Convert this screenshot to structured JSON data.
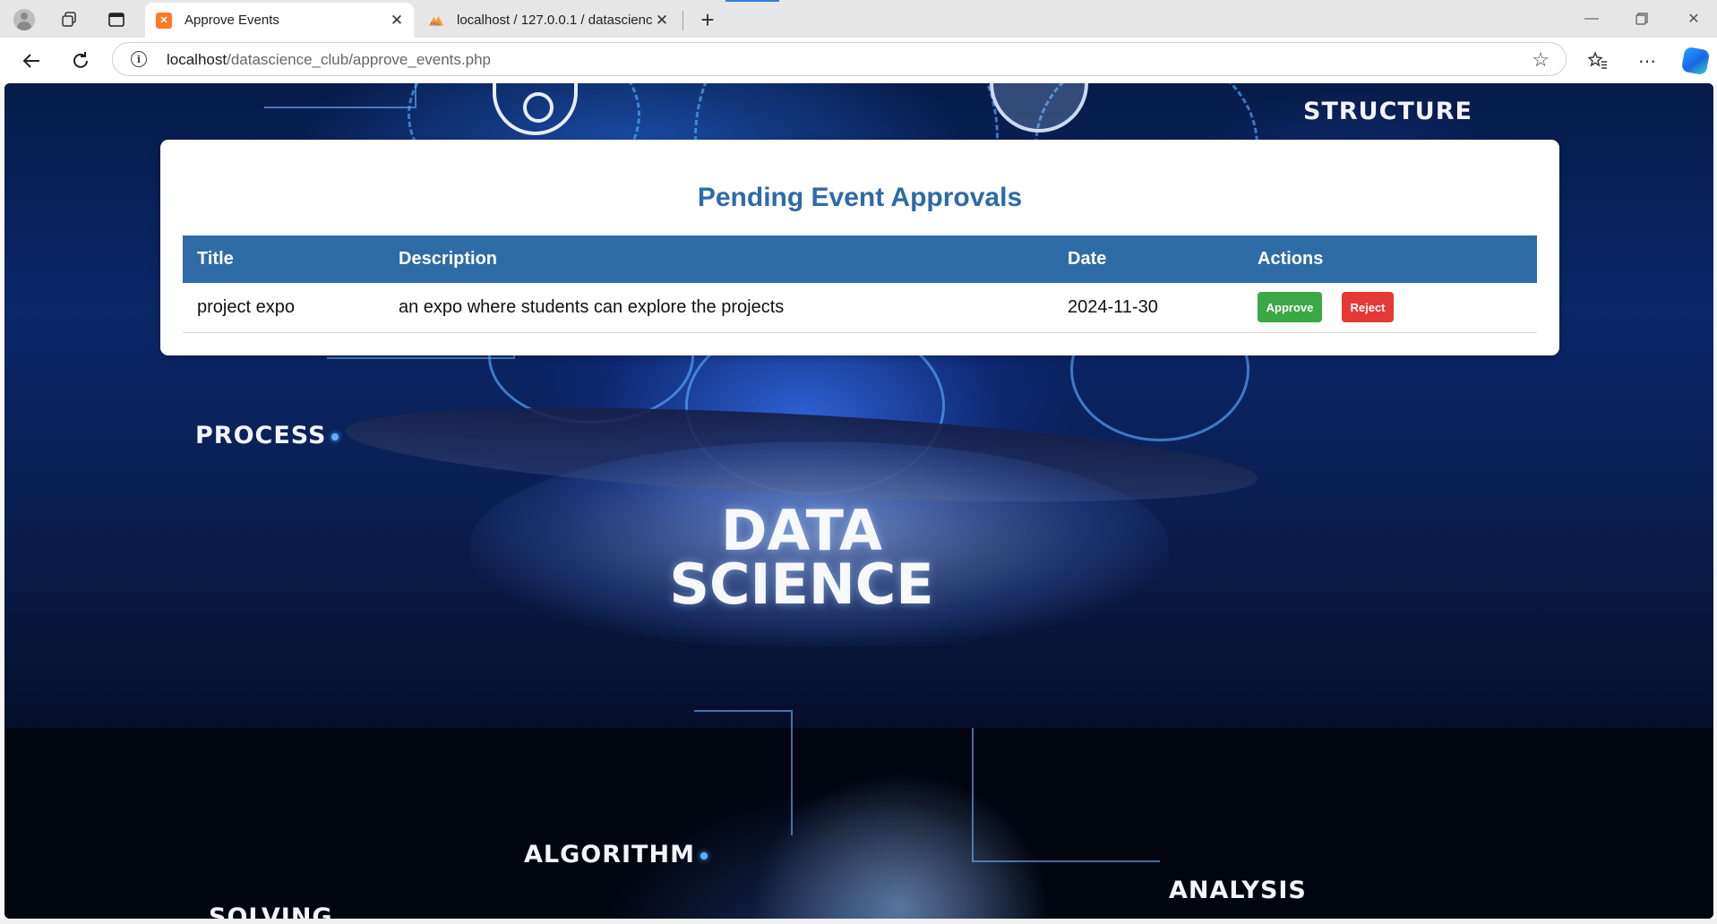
{
  "browser": {
    "tabs": [
      {
        "title": "Approve Events",
        "active": true,
        "favicon": "xampp-icon"
      },
      {
        "title": "localhost / 127.0.0.1 / datascience",
        "active": false,
        "favicon": "phpmyadmin-icon"
      }
    ],
    "address": {
      "host": "localhost",
      "path": "/datascience_club/approve_events.php"
    }
  },
  "background": {
    "words": {
      "structure": "STRUCTURE",
      "process": "PROCESS",
      "algorithm": "ALGORITHM",
      "analysis": "ANALYSIS",
      "solving": "SOLVING"
    },
    "title_line1": "DATA",
    "title_line2": "SCIENCE"
  },
  "page": {
    "heading": "Pending Event Approvals",
    "columns": [
      "Title",
      "Description",
      "Date",
      "Actions"
    ],
    "rows": [
      {
        "title": "project expo",
        "description": "an expo where students can explore the projects",
        "date": "2024-11-30",
        "approve_label": "Approve",
        "reject_label": "Reject"
      }
    ]
  },
  "colors": {
    "heading": "#2d6aa9",
    "table_header": "#2f6ba6",
    "approve": "#3aa845",
    "reject": "#e53935"
  }
}
